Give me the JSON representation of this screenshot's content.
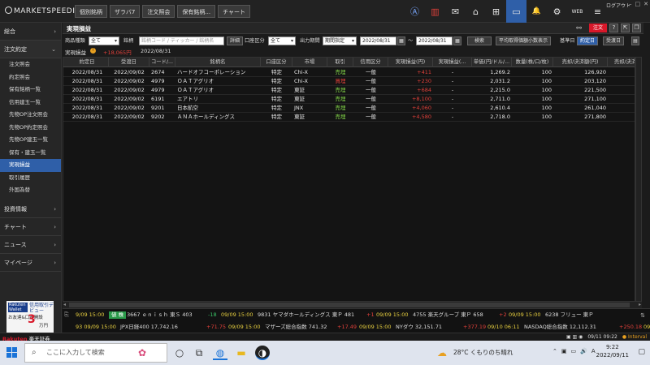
{
  "app": {
    "logo_text": "MARKETSPEEDⅡ"
  },
  "top_tabs": [
    "個別銘柄",
    "ザラバ7",
    "注文照会",
    "保有銘柄...",
    "チャート"
  ],
  "top_icons": [
    "chart-icon",
    "market-icon",
    "news-icon",
    "home-icon",
    "add-window-icon",
    "layout-icon",
    "bell-icon",
    "gear-icon",
    "web-icon",
    "menu-icon"
  ],
  "top_icon_glyphs": [
    "Ⓐ",
    "▥",
    "✉",
    "⌂",
    "⊞",
    "▭",
    "🔔",
    "⚙",
    "WEB",
    "≡"
  ],
  "logout_label": "ログアウト",
  "sidebar": {
    "sections": [
      {
        "label": "総合"
      },
      {
        "label": "注文約定"
      },
      {
        "label": "投資情報"
      },
      {
        "label": "チャート"
      },
      {
        "label": "ニュース"
      },
      {
        "label": "マイページ"
      }
    ],
    "items": [
      "注文照会",
      "約定照会",
      "保有銘柄一覧",
      "信用建玉一覧",
      "先物OP注文照会",
      "先物OP約定照会",
      "先物OP建玉一覧",
      "保有・建玉一覧",
      "実現損益",
      "取引履歴",
      "外国為替"
    ],
    "ad": {
      "brand": "Rakuten Wallet",
      "title": "信用取引デビュー",
      "line": "お友達&口座開設",
      "amount": "3",
      "suffix": "万円"
    }
  },
  "main": {
    "title": "実現損益",
    "order_button": "注文",
    "filter": {
      "product_type_label": "商品種類",
      "product_type_value": "全て",
      "stock_label": "銘柄",
      "stock_placeholder": "銘柄コード / ティッカー / 銘柄名",
      "detail_button": "詳細",
      "account_label": "口座区分",
      "account_value": "全て",
      "period_label": "出力期間",
      "period_value": "期間指定",
      "date_from": "2022/08/31",
      "date_sep": "～",
      "date_to": "2022/08/31",
      "search_button": "検索",
      "avg_button": "平均取得価額小数表示",
      "base_date_label": "基準日",
      "contract_date_button": "約定日",
      "delivery_date_button": "受渡日"
    },
    "summary": {
      "label": "実現損益",
      "value": "+18,065円",
      "date": "2022/08/31"
    }
  },
  "table": {
    "headers": [
      "約定日",
      "受渡日",
      "コード/...",
      "銘柄名",
      "口座区分",
      "市場",
      "取引",
      "信用区分",
      "実現損益(円)",
      "実現損益(...",
      "単価(円/ドル/...",
      "数量(株/口/枚)",
      "売却/決済額(円)",
      "売却/決済..."
    ],
    "rows": [
      [
        "2022/08/31",
        "2022/09/02",
        "2674",
        "ハードオフコーポレーション",
        "特定",
        "Chi-X",
        "売埋",
        "一般",
        "+411",
        "-",
        "1,269.2",
        "100",
        "126,920"
      ],
      [
        "2022/08/31",
        "2022/09/02",
        "4979",
        "ＯＡＴアグリオ",
        "特定",
        "Chi-X",
        "買埋",
        "一般",
        "+230",
        "-",
        "2,031.2",
        "100",
        "203,120"
      ],
      [
        "2022/08/31",
        "2022/09/02",
        "4979",
        "ＯＡＴアグリオ",
        "特定",
        "東証",
        "売埋",
        "一般",
        "+684",
        "-",
        "2,215.0",
        "100",
        "221,500"
      ],
      [
        "2022/08/31",
        "2022/09/02",
        "6191",
        "エアトリ",
        "特定",
        "東証",
        "売埋",
        "一般",
        "+8,100",
        "-",
        "2,711.0",
        "100",
        "271,100"
      ],
      [
        "2022/08/31",
        "2022/09/02",
        "9201",
        "日本航空",
        "特定",
        "JNX",
        "売埋",
        "一般",
        "+4,060",
        "-",
        "2,610.4",
        "100",
        "261,040"
      ],
      [
        "2022/08/31",
        "2022/09/02",
        "9202",
        "ＡＮＡホールディングス",
        "特定",
        "東証",
        "売埋",
        "一般",
        "+4,580",
        "-",
        "2,718.0",
        "100",
        "271,800"
      ]
    ]
  },
  "ticker": {
    "line1": [
      {
        "text": "9/09 15:00",
        "cls": "lbl"
      },
      {
        "text": "値 株",
        "cls": "badge"
      },
      {
        "text": "3667 ｅｎｉｓｈ 東Ｓ 403",
        "cls": "tw"
      },
      {
        "text": "-18",
        "cls": "dn"
      },
      {
        "text": "09/09 15:00",
        "cls": "lbl"
      },
      {
        "text": "9831 ヤマダホールディングス 東Ｐ 481",
        "cls": "tw"
      },
      {
        "text": "+1",
        "cls": "up"
      },
      {
        "text": "09/09 15:00",
        "cls": "lbl"
      },
      {
        "text": "4755 楽天グループ 東Ｐ 658",
        "cls": "tw"
      },
      {
        "text": "+2",
        "cls": "up"
      },
      {
        "text": "09/09 15:00",
        "cls": "lbl"
      },
      {
        "text": "6238 フリュー 東Ｐ",
        "cls": "tw"
      }
    ],
    "line2": [
      {
        "text": "93 09/09 15:00",
        "cls": "lbl"
      },
      {
        "text": "JPX日経400 17,742.16",
        "cls": "tw"
      },
      {
        "text": "+71.75",
        "cls": "up"
      },
      {
        "text": "09/09 15:00",
        "cls": "lbl"
      },
      {
        "text": "マザーズ総合指数 741.32",
        "cls": "tw"
      },
      {
        "text": "+17.49",
        "cls": "up"
      },
      {
        "text": "09/09 15:00",
        "cls": "lbl"
      },
      {
        "text": "NYダウ 32,151.71",
        "cls": "tw"
      },
      {
        "text": "+377.19",
        "cls": "up"
      },
      {
        "text": "09/10 06:11",
        "cls": "lbl"
      },
      {
        "text": "NASDAQ総合指数 12,112.31",
        "cls": "tw"
      },
      {
        "text": "+250.18",
        "cls": "up"
      },
      {
        "text": "09",
        "cls": "lbl"
      }
    ]
  },
  "status": {
    "brand_prefix": "Rakuten",
    "brand_suffix": "楽天証券",
    "datetime": "09/11 09:22",
    "interval": "Interval"
  },
  "taskbar": {
    "search_placeholder": "ここに入力して検索",
    "weather": "28°C くもりのち晴れ",
    "time": "9:22",
    "date": "2022/09/11"
  },
  "colors": {
    "accent": "#2f5fa8",
    "up": "#e0403a",
    "down": "#39c065",
    "order": "#d8182a"
  }
}
